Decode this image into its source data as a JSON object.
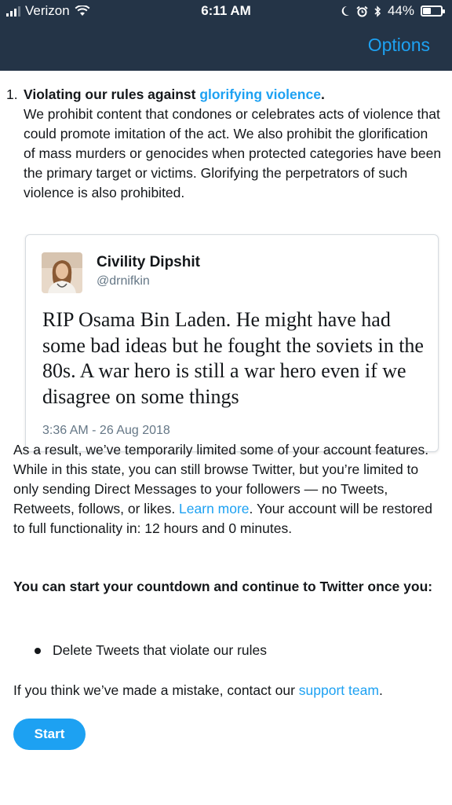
{
  "status_bar": {
    "carrier": "Verizon",
    "time": "6:11 AM",
    "battery": "44%"
  },
  "nav": {
    "options_label": "Options"
  },
  "rule": {
    "number": "1.",
    "title_prefix": "Violating our rules against ",
    "title_link": "glorifying violence",
    "title_suffix": ".",
    "description": "We prohibit content that condones or celebrates acts of violence that could promote imitation of the act. We also prohibit the glorification of mass murders or genocides when protected categories have been the primary target or victims. Glorifying the perpetrators of such violence is also prohibited."
  },
  "tweet": {
    "display_name": "Civility Dipshit",
    "handle": "@drnifkin",
    "text": "RIP Osama Bin Laden. He might have had some bad ideas but he fought the soviets in the 80s. A war hero is still a war hero even if we disagree on some things",
    "timestamp": "3:36 AM - 26 Aug 2018"
  },
  "result": {
    "text_before": "As a result, we’ve temporarily limited some of your account features. While in this state, you can still browse Twitter, but you’re limited to only sending Direct Messages to your followers — no Tweets, Retweets, follows, or likes. ",
    "learn_more": "Learn more",
    "text_after": ". Your account will be restored to full functionality in: 12 hours and 0 minutes."
  },
  "countdown_title": "You can start your countdown and continue to Twitter once you:",
  "steps": [
    "Delete Tweets that violate our rules"
  ],
  "mistake": {
    "text_before": "If you think we’ve made a mistake, contact our ",
    "link": "support team",
    "text_after": "."
  },
  "start_button": "Start",
  "colors": {
    "header_bg": "#243447",
    "accent": "#1da1f2"
  }
}
